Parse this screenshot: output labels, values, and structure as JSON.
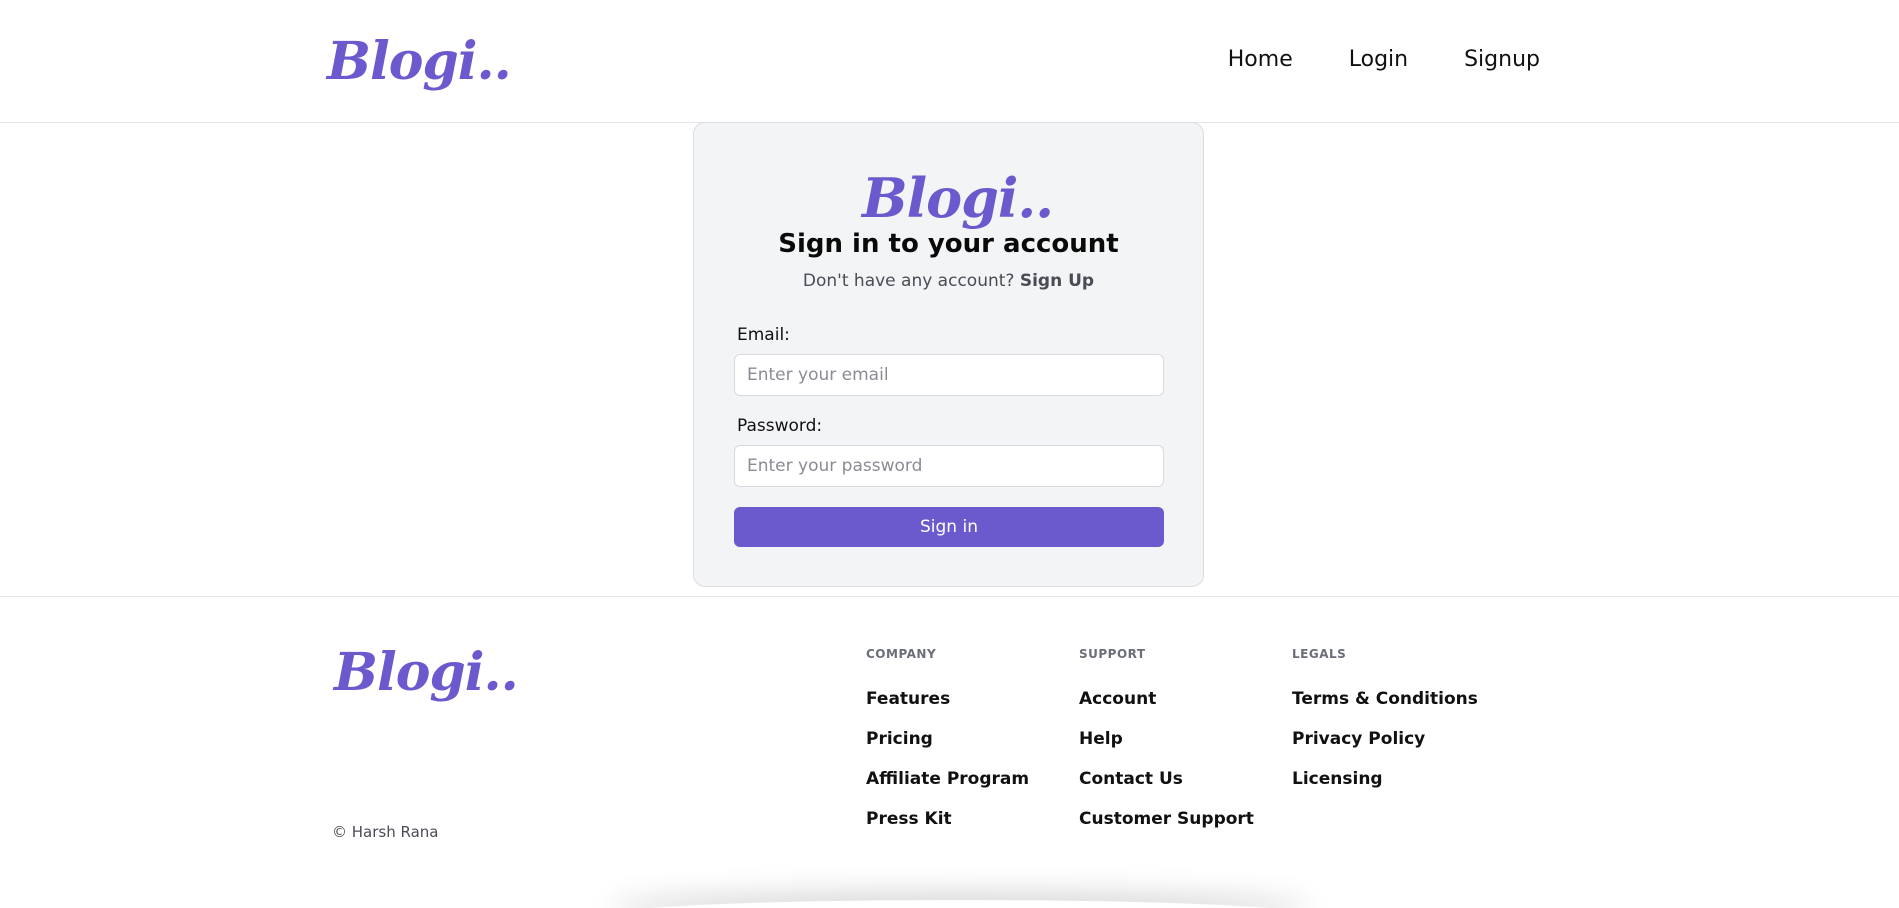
{
  "brand": {
    "logo_text": "Blogi..",
    "accent_color": "#6a5acd"
  },
  "header": {
    "nav": [
      {
        "label": "Home"
      },
      {
        "label": "Login"
      },
      {
        "label": "Signup"
      }
    ]
  },
  "signin": {
    "title": "Sign in to your account",
    "subtitle_prefix": "Don't have any account?",
    "subtitle_link": "Sign Up",
    "email_label": "Email:",
    "email_placeholder": "Enter your email",
    "password_label": "Password:",
    "password_placeholder": "Enter your password",
    "submit_label": "Sign in"
  },
  "footer": {
    "copyright": "© Harsh Rana",
    "columns": [
      {
        "heading": "COMPANY",
        "links": [
          "Features",
          "Pricing",
          "Affiliate Program",
          "Press Kit"
        ]
      },
      {
        "heading": "SUPPORT",
        "links": [
          "Account",
          "Help",
          "Contact Us",
          "Customer Support"
        ]
      },
      {
        "heading": "LEGALS",
        "links": [
          "Terms & Conditions",
          "Privacy Policy",
          "Licensing"
        ]
      }
    ]
  }
}
